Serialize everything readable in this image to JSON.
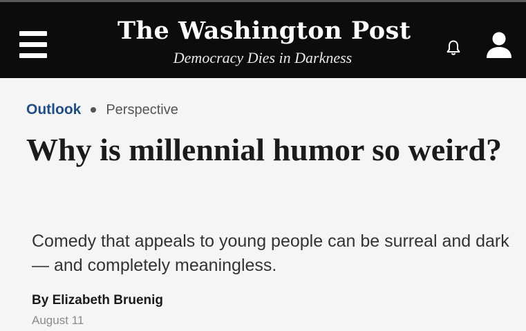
{
  "header": {
    "logo": "The Washington Post",
    "tagline": "Democracy Dies in Darkness",
    "icons": {
      "menu": "hamburger-menu-icon",
      "notifications": "bell-icon",
      "account": "user-icon"
    }
  },
  "article": {
    "section": "Outlook",
    "label": "Perspective",
    "headline": "Why is millennial humor so weird?",
    "subhead": "Comedy that appeals to young people can be surreal and dark — and completely meaningless.",
    "byline_prefix": "By ",
    "author": "Elizabeth Bruenig",
    "date": "August 11"
  },
  "colors": {
    "header_bg": "#0c0c0c",
    "section_link": "#1f4e86",
    "page_bg": "#f5f5f5",
    "headline": "#1b1b1b",
    "date": "#8a8a8a"
  }
}
